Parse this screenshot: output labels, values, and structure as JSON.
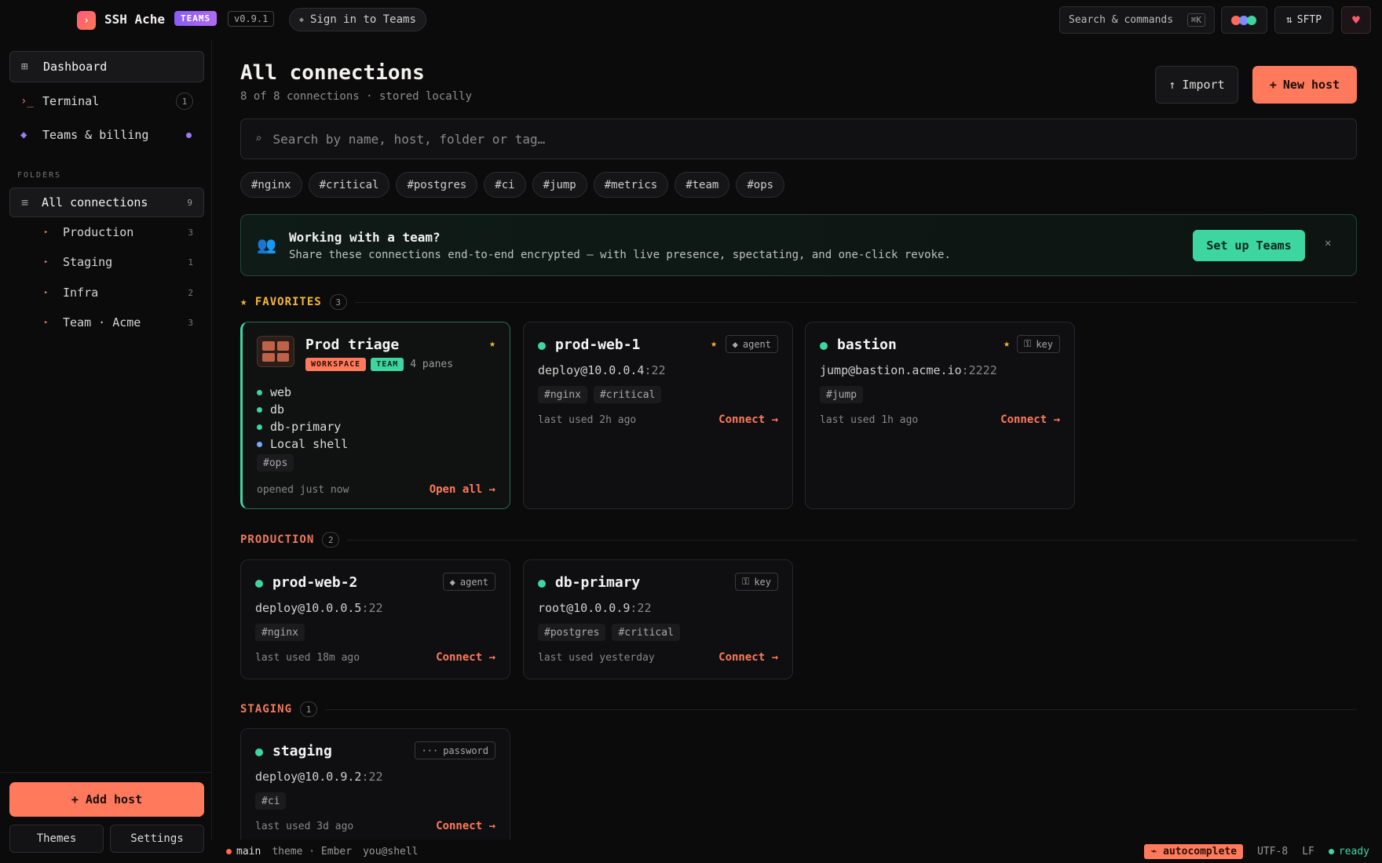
{
  "app": {
    "title": "SSH Ache",
    "plan_badge": "TEAMS",
    "version": "v0.9.1",
    "signin_label": "Sign in to Teams",
    "search_label": "Search & commands",
    "search_shortcut": "⌘K",
    "sftp_label": "SFTP",
    "theme_colors": [
      "#ff6a5a",
      "#7a8cff",
      "#3ed6a0"
    ]
  },
  "sidebar": {
    "nav": [
      {
        "icon": "grid-icon",
        "label": "Dashboard",
        "active": true
      },
      {
        "icon": "terminal-icon",
        "label": "Terminal",
        "count": "1"
      },
      {
        "icon": "diamond-icon",
        "label": "Teams & billing"
      }
    ],
    "folders_label": "FOLDERS",
    "all_connections": {
      "label": "All connections",
      "count": "9"
    },
    "folders": [
      {
        "label": "Production",
        "count": "3"
      },
      {
        "label": "Staging",
        "count": "1"
      },
      {
        "label": "Infra",
        "count": "2"
      },
      {
        "label": "Team · Acme",
        "count": "3"
      }
    ],
    "add_host_label": "+ Add host",
    "themes_label": "Themes",
    "settings_label": "Settings"
  },
  "main": {
    "title": "All connections",
    "subtitle": "8 of 8 connections · stored locally",
    "import_label": "Import",
    "new_host_label": "New host",
    "search_placeholder": "Search by name, host, folder or tag…",
    "tags": [
      "#nginx",
      "#critical",
      "#postgres",
      "#ci",
      "#jump",
      "#metrics",
      "#team",
      "#ops"
    ],
    "banner": {
      "title": "Working with a team?",
      "description": "Share these connections end-to-end encrypted — with live presence, spectating, and one-click revoke.",
      "button": "Set up Teams"
    },
    "sections": {
      "favorites": {
        "label": "FAVORITES",
        "count": "3"
      },
      "production": {
        "label": "PRODUCTION",
        "count": "2"
      },
      "staging": {
        "label": "STAGING",
        "count": "1"
      }
    },
    "workspace": {
      "title": "Prod triage",
      "badge_workspace": "WORKSPACE",
      "badge_team": "TEAM",
      "panes_label": "4 panes",
      "panes": [
        "web",
        "db",
        "db-primary",
        "Local shell"
      ],
      "tag": "#ops",
      "opened": "opened just now",
      "action": "Open all →"
    },
    "hosts": {
      "prod_web_1": {
        "name": "prod-web-1",
        "auth": "agent",
        "user_host": "deploy@10.0.0.4",
        "port": ":22",
        "tags": [
          "#nginx",
          "#critical"
        ],
        "last_used": "last used 2h ago",
        "action": "Connect →"
      },
      "bastion": {
        "name": "bastion",
        "auth": "key",
        "user_host": "jump@bastion.acme.io",
        "port": ":2222",
        "tags": [
          "#jump"
        ],
        "last_used": "last used 1h ago",
        "action": "Connect →"
      },
      "prod_web_2": {
        "name": "prod-web-2",
        "auth": "agent",
        "user_host": "deploy@10.0.0.5",
        "port": ":22",
        "tags": [
          "#nginx"
        ],
        "last_used": "last used 18m ago",
        "action": "Connect →"
      },
      "db_primary": {
        "name": "db-primary",
        "auth": "key",
        "user_host": "root@10.0.0.9",
        "port": ":22",
        "tags": [
          "#postgres",
          "#critical"
        ],
        "last_used": "last used yesterday",
        "action": "Connect →"
      },
      "staging": {
        "name": "staging",
        "auth": "password",
        "user_host": "deploy@10.0.9.2",
        "port": ":22",
        "tags": [
          "#ci"
        ],
        "last_used": "last used 3d ago",
        "action": "Connect →"
      }
    }
  },
  "statusbar": {
    "branch": "main",
    "theme": "theme · Ember",
    "user": "you@shell",
    "autocomplete": "⌁ autocomplete",
    "encoding": "UTF-8",
    "line_ending": "LF",
    "status": "ready"
  }
}
